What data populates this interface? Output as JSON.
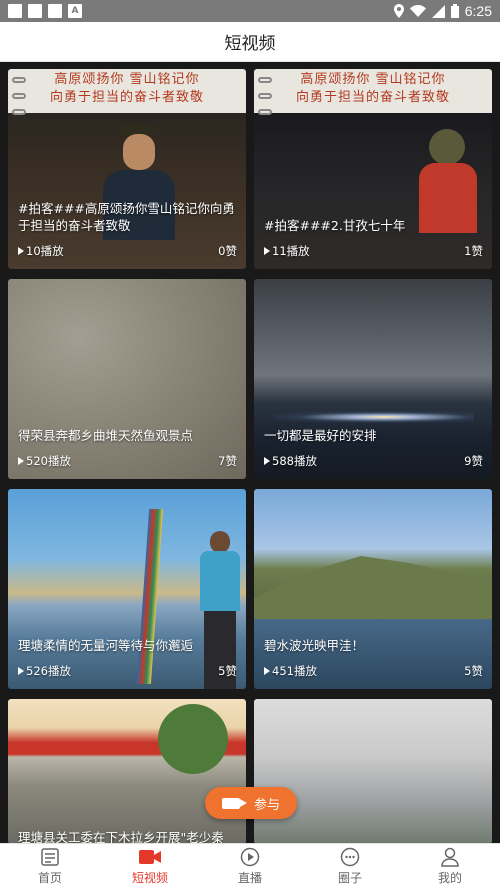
{
  "status_bar": {
    "time": "6:25",
    "badge_letter": "A"
  },
  "header": {
    "title": "短视频"
  },
  "cards": [
    {
      "banner": "高原颂扬你 雪山铭记你\n向勇于担当的奋斗者致敬",
      "title": "#拍客###高原颂扬你雪山铭记你向勇于担当的奋斗者致敬",
      "plays": "10播放",
      "likes": "0赞"
    },
    {
      "banner": "高原颂扬你 雪山铭记你\n向勇于担当的奋斗者致敬",
      "title": "#拍客###2.甘孜七十年",
      "plays": "11播放",
      "likes": "1赞"
    },
    {
      "title": "得荣县奔都乡曲堆天然鱼观景点",
      "plays": "520播放",
      "likes": "7赞"
    },
    {
      "title": "一切都是最好的安排",
      "plays": "588播放",
      "likes": "9赞"
    },
    {
      "title": "理塘柔情的无量河等待与你邂逅",
      "plays": "526播放",
      "likes": "5赞"
    },
    {
      "title": "碧水波光映甲洼！",
      "plays": "451播放",
      "likes": "5赞"
    },
    {
      "title": "理塘县关工委在下木拉乡开展\"老少秦",
      "plays": "",
      "likes": ""
    },
    {
      "title": "",
      "plays": "",
      "likes": ""
    }
  ],
  "join_button": {
    "label": "参与"
  },
  "nav": [
    {
      "label": "首页",
      "icon": "home-icon"
    },
    {
      "label": "短视频",
      "icon": "video-camera-icon"
    },
    {
      "label": "直播",
      "icon": "play-circle-icon"
    },
    {
      "label": "圈子",
      "icon": "chat-bubble-icon"
    },
    {
      "label": "我的",
      "icon": "user-icon"
    }
  ],
  "colors": {
    "accent": "#e4392a",
    "join": "#f0722f",
    "feed_bg": "#191919",
    "status_bar": "#7a7a7a"
  }
}
